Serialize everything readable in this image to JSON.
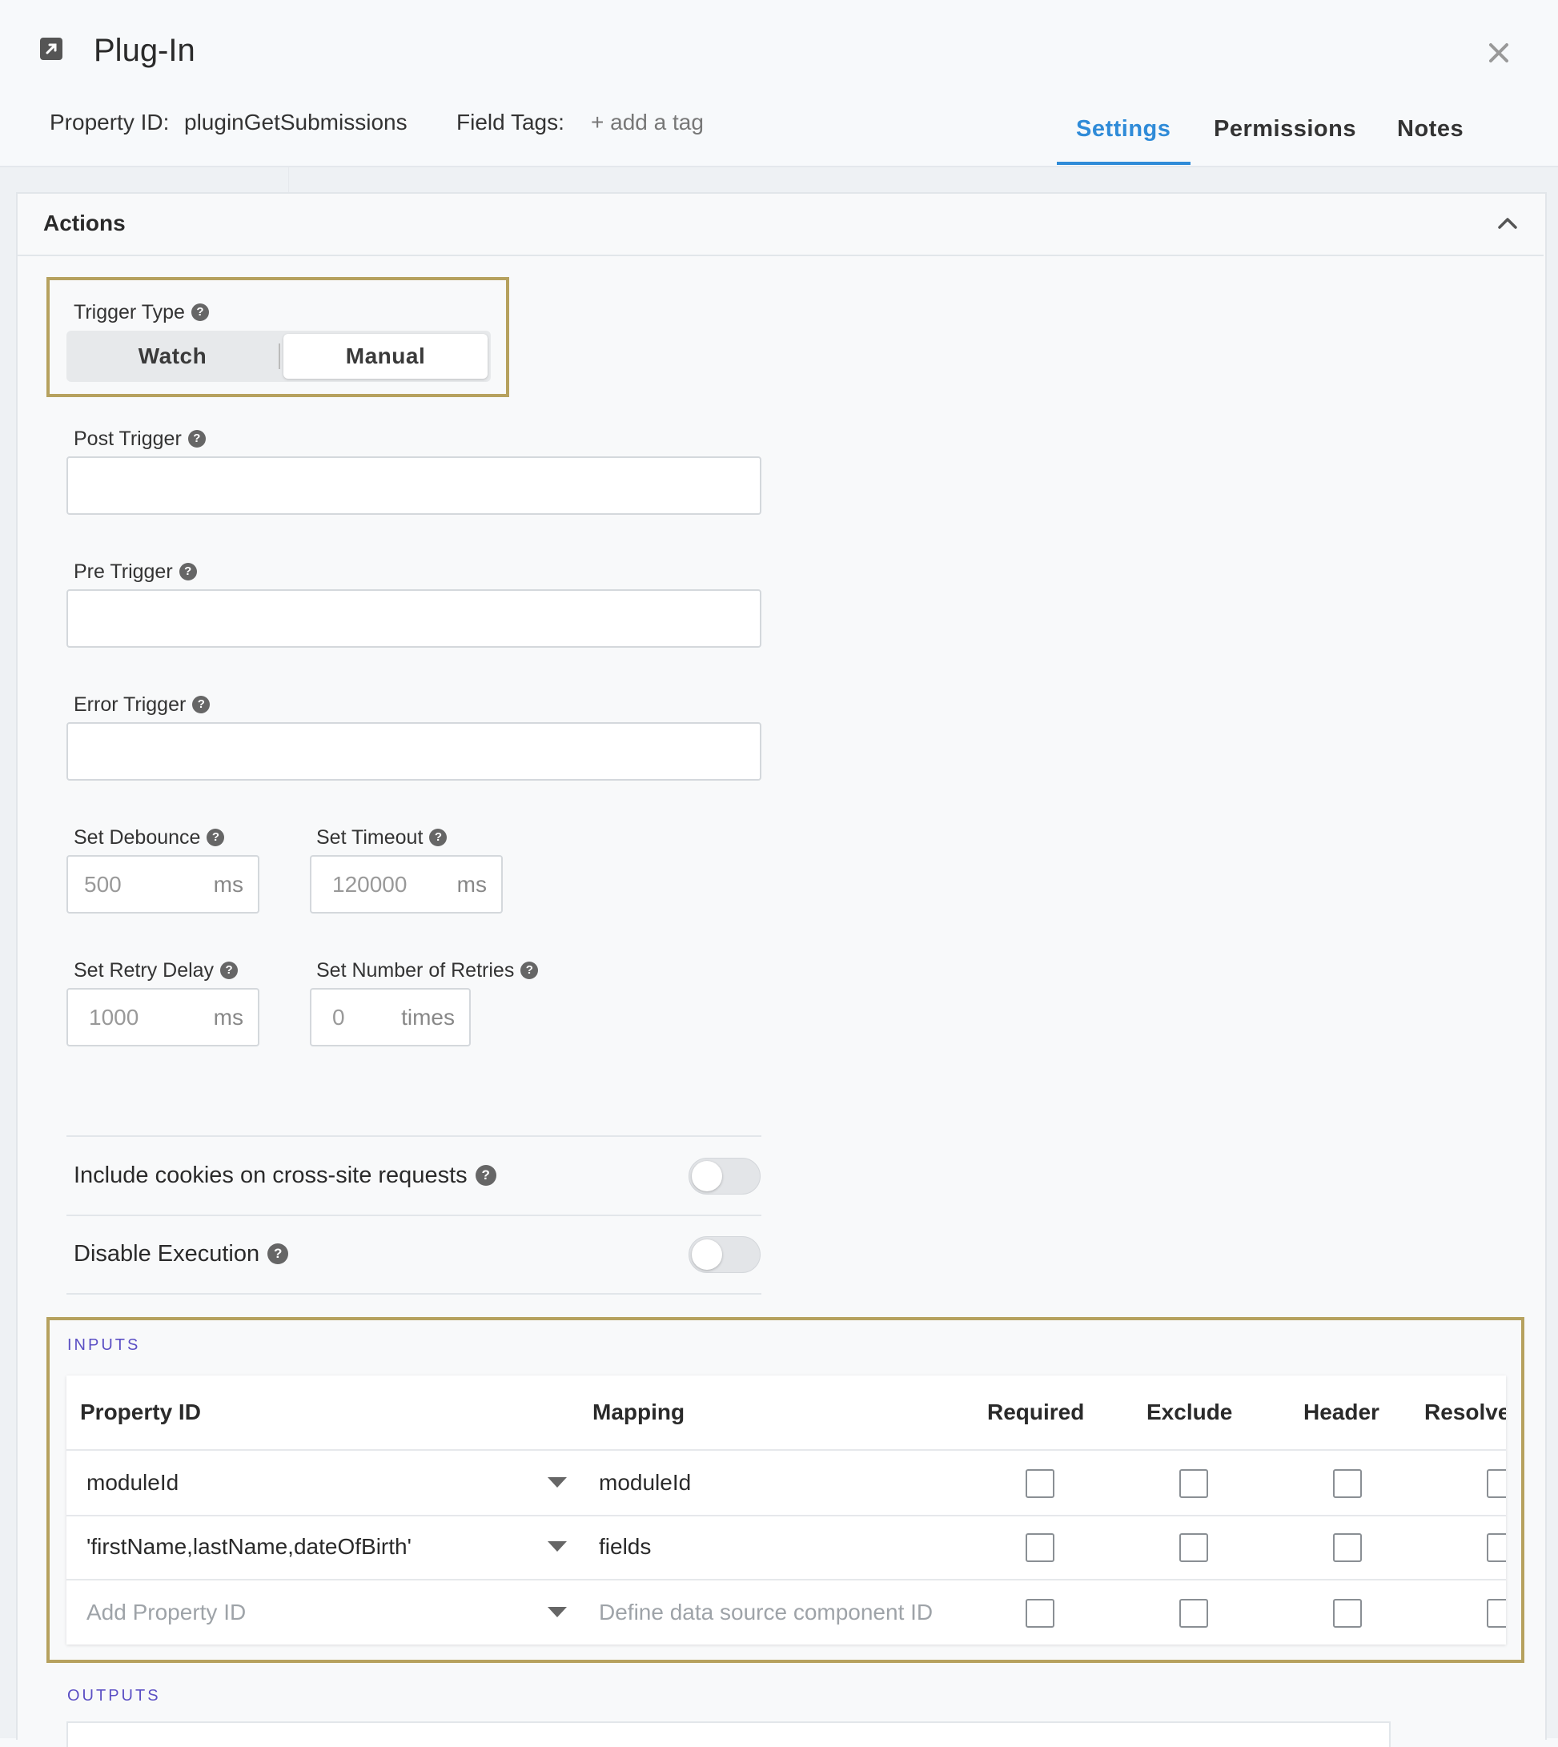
{
  "dialog": {
    "title": "Plug-In",
    "property_id_label": "Property ID:",
    "property_id_value": "pluginGetSubmissions",
    "field_tags_label": "Field Tags:",
    "add_tag_label": "+ add a tag"
  },
  "tabs": [
    {
      "label": "Settings",
      "active": true
    },
    {
      "label": "Permissions",
      "active": false
    },
    {
      "label": "Notes",
      "active": false
    }
  ],
  "section": {
    "title": "Actions"
  },
  "trigger_type": {
    "label": "Trigger Type",
    "options": [
      "Watch",
      "Manual"
    ],
    "selected": "Manual"
  },
  "post_trigger": {
    "label": "Post Trigger",
    "value": ""
  },
  "pre_trigger": {
    "label": "Pre Trigger",
    "value": ""
  },
  "error_trigger": {
    "label": "Error Trigger",
    "value": ""
  },
  "debounce": {
    "label": "Set Debounce",
    "placeholder": "500",
    "unit": "ms"
  },
  "timeout": {
    "label": "Set Timeout",
    "placeholder": "120000",
    "unit": "ms"
  },
  "retry_delay": {
    "label": "Set Retry Delay",
    "placeholder": "1000",
    "unit": "ms"
  },
  "retries": {
    "label": "Set Number of Retries",
    "placeholder": "0",
    "unit": "times"
  },
  "toggles": [
    {
      "label": "Include cookies on cross-site requests",
      "on": false
    },
    {
      "label": "Disable Execution",
      "on": false
    }
  ],
  "inputs": {
    "heading": "INPUTS",
    "columns": [
      "Property ID",
      "Mapping",
      "Required",
      "Exclude",
      "Header",
      "Resolve"
    ],
    "rows": [
      {
        "property_id": "moduleId",
        "mapping": "moduleId"
      },
      {
        "property_id": "'firstName,lastName,dateOfBirth'",
        "mapping": "fields"
      }
    ],
    "new_row": {
      "property_placeholder": "Add Property ID",
      "mapping_placeholder": "Define data source component ID"
    }
  },
  "outputs": {
    "heading": "OUTPUTS"
  },
  "colors": {
    "accent": "#2f8bd8",
    "highlight": "#b6a15e",
    "section_label": "#5b4fc4"
  },
  "icons": [
    "external-link-icon",
    "close-icon",
    "chevron-up-icon",
    "help-icon",
    "caret-down-icon"
  ]
}
